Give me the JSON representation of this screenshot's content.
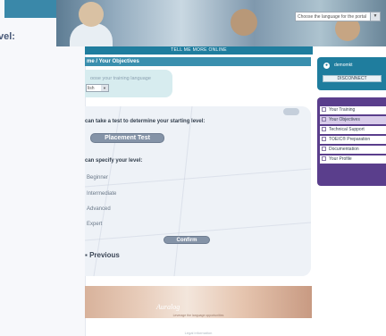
{
  "left_panel": {
    "heading": "vel:"
  },
  "header": {
    "language_select_value": "Choose the language for the portal",
    "tagline": "TELL ME MORE ONLINE"
  },
  "breadcrumb": "me / Your Objectives",
  "training_language": {
    "label": "oose your training language",
    "value": "lish"
  },
  "placement": {
    "intro": "can take a test to determine your starting level:",
    "button_label": "Placement Test"
  },
  "level": {
    "intro": "can specify your level:",
    "options": [
      "Beginner",
      "Intermediate",
      "Advanced",
      "Expert"
    ],
    "confirm_label": "Confirm"
  },
  "previous_label": "Previous",
  "footer": {
    "logo": "Auralog",
    "subtext": "Leverage the language opportunities",
    "bottom": "Legal information"
  },
  "user": {
    "name": "demomkt",
    "disconnect_label": "DISCONNECT"
  },
  "nav": {
    "items": [
      "Your Training",
      "Your Objectives",
      "Technical Support",
      "TOEIC® Preparation",
      "Documentation",
      "Your Profile"
    ],
    "active_index": 1
  },
  "colors": {
    "accent": "#1f7d9e",
    "nav_bg": "#5a3e8c",
    "button": "#8493a7"
  }
}
